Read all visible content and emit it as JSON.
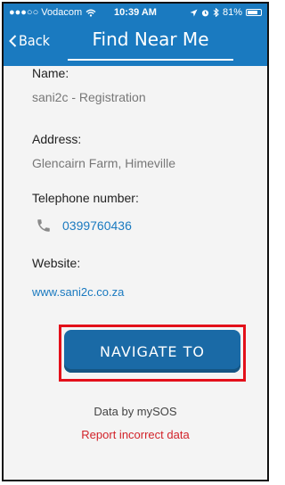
{
  "status_bar": {
    "carrier": "●●●○○ Vodacom",
    "time": "10:39 AM",
    "battery": "81%",
    "battery_level": 0.81
  },
  "nav": {
    "back_label": "Back",
    "title": "Find Near Me"
  },
  "details": {
    "name_label": "Name:",
    "name_value": "sani2c - Registration",
    "address_label": "Address:",
    "address_value": "Glencairn Farm, Himeville",
    "phone_label": "Telephone number:",
    "phone_value": "0399760436",
    "website_label": "Website:",
    "website_value": "www.sani2c.co.za"
  },
  "actions": {
    "navigate_label": "NAVIGATE TO",
    "data_by": "Data by mySOS",
    "report_label": "Report incorrect data"
  },
  "colors": {
    "brand_blue": "#1a7ac0",
    "button_blue": "#1a6aa6",
    "highlight_red": "#e3101a",
    "report_red": "#d2232a"
  },
  "icons": {
    "phone": "phone-icon",
    "back": "chevron-left-icon",
    "wifi": "wifi-icon",
    "bluetooth": "bluetooth-icon",
    "location": "location-arrow-icon",
    "alarm": "alarm-icon",
    "battery": "battery-icon"
  }
}
